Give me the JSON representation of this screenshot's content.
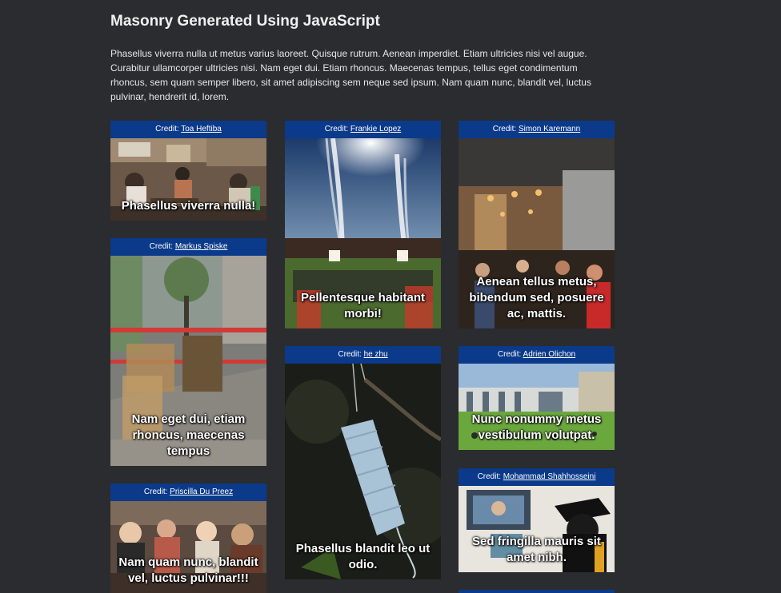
{
  "page": {
    "title": "Masonry Generated Using JavaScript",
    "intro": "Phasellus viverra nulla ut metus varius laoreet. Quisque rutrum. Aenean imperdiet. Etiam ultricies nisi vel augue. Curabitur ullamcorper ultricies nisi. Nam eget dui. Etiam rhoncus. Maecenas tempus, tellus eget condimentum rhoncus, sem quam semper libero, sit amet adipiscing sem neque sed ipsum. Nam quam nunc, blandit vel, luctus pulvinar, hendrerit id, lorem."
  },
  "credit_prefix": "Credit:",
  "cards": [
    {
      "credit": "Toa Heftiba",
      "caption": "Phasellus viverra nulla!",
      "scene": "cafe"
    },
    {
      "credit": "Markus Spiske",
      "caption": "Nam eget dui, etiam rhoncus, maecenas tempus",
      "scene": "street"
    },
    {
      "credit": "Priscilla Du Preez",
      "caption": "Nam quam nunc, blandit vel, luctus pulvinar!!!",
      "scene": "crowd"
    },
    {
      "credit": "Frankie Lopez",
      "caption": "Pellentesque habitant morbi!",
      "scene": "stadium"
    },
    {
      "credit": "he zhu",
      "caption": "Phasellus blandit leo ut odio.",
      "scene": "mask"
    },
    {
      "credit": "Simon Karemann",
      "caption": "Aenean tellus metus, bibendum sed, posuere ac, mattis.",
      "scene": "hall"
    },
    {
      "credit": "Adrien Olichon",
      "caption": "Nunc nonummy metus vestibulum volutpat.",
      "scene": "lawn"
    },
    {
      "credit": "Mohammad Shahhosseini",
      "caption": "Sed fringilla mauris sit amet nibh.",
      "scene": "graduate"
    }
  ]
}
